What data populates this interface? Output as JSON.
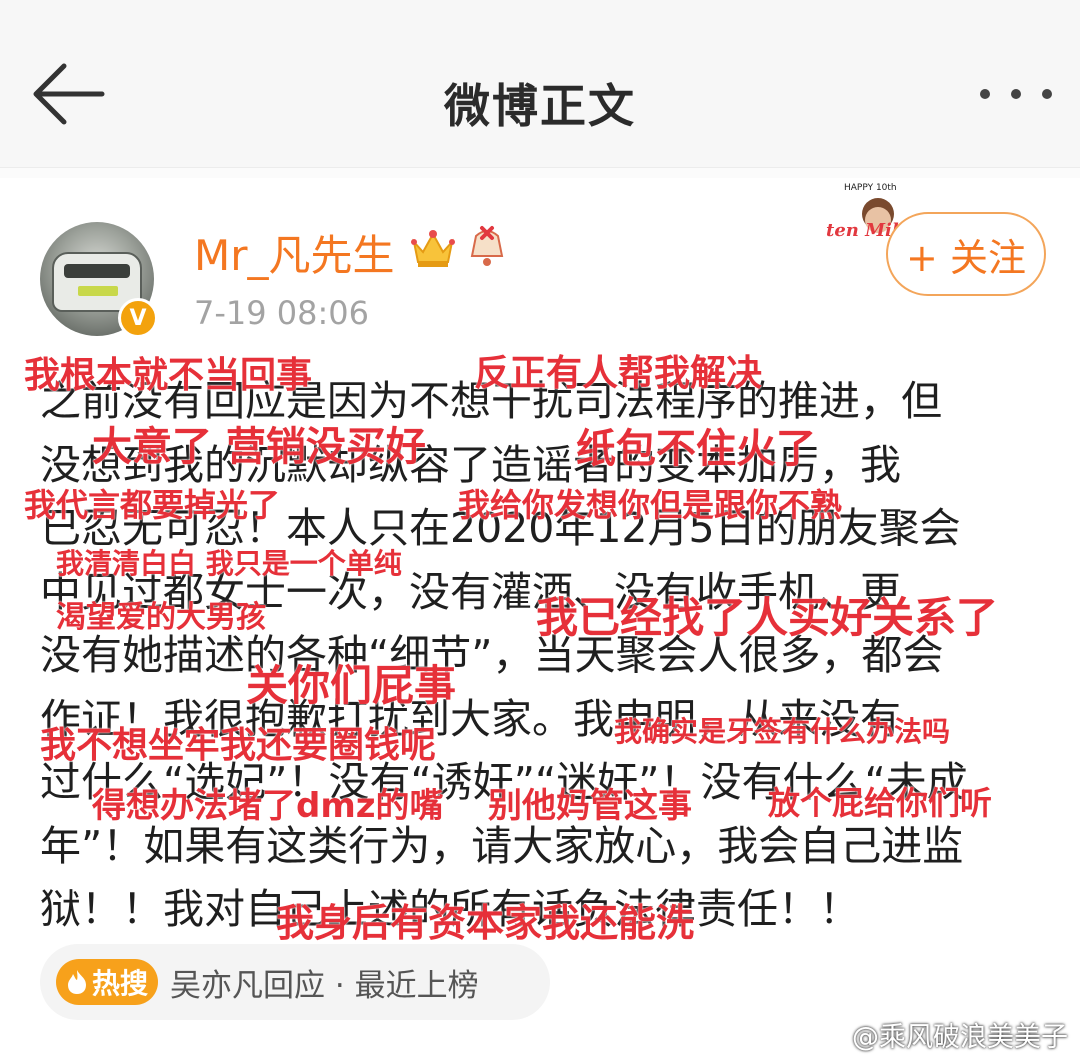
{
  "header": {
    "title": "微博正文"
  },
  "post": {
    "username": "Mr_凡先生",
    "timestamp": "7-19 08:06",
    "verified_mark": "V",
    "follow_label": "+ 关注",
    "badge_text_top": "HAPPY 10th",
    "badge_text_main": "ten Million",
    "text_lines": [
      "之前没有回应是因为不想干扰司法程序的推进，但",
      "没想到我的沉默却纵容了造谣者的变本加厉，我",
      "已忍无可忍！本人只在2020年12月5日的朋友聚会",
      "中见过都女士一次，没有灌酒、没有收手机、更",
      "没有她描述的各种“细节”，当天聚会人很多，都会",
      "作证！我很抱歉打扰到大家。我申明，从来没有",
      "过什么“选妃”！没有“诱奸”“迷奸”！没有什么“未成",
      "年”！如果有这类行为，请大家放心，我会自己进监",
      "狱！！我对自己上述的所有话负法律责任！！"
    ],
    "hot_search": {
      "tag": "热搜",
      "text": "吴亦凡回应 · 最近上榜"
    }
  },
  "annotations": [
    "我根本就不当回事",
    "反正有人帮我解决",
    "大意了 营销没买好",
    "纸包不住火了",
    "我代言都要掉光了",
    "我给你发想你但是跟你不熟",
    "我清清白白 我只是一个单纯",
    "渴望爱的大男孩",
    "我已经找了人买好关系了",
    "关你们屁事",
    "我不想坐牢我还要圈钱呢",
    "我确实是牙签有什么办法吗",
    "得想办法堵了dmz的嘴",
    "别他妈管这事",
    "放个屁给你们听",
    "我身后有资本家我还能洗"
  ],
  "watermark": "@乘风破浪美美子",
  "colors": {
    "annotation": "#e63039",
    "username": "#f47721",
    "verified": "#f3a20d",
    "hot_tag": "#f7a11b"
  }
}
